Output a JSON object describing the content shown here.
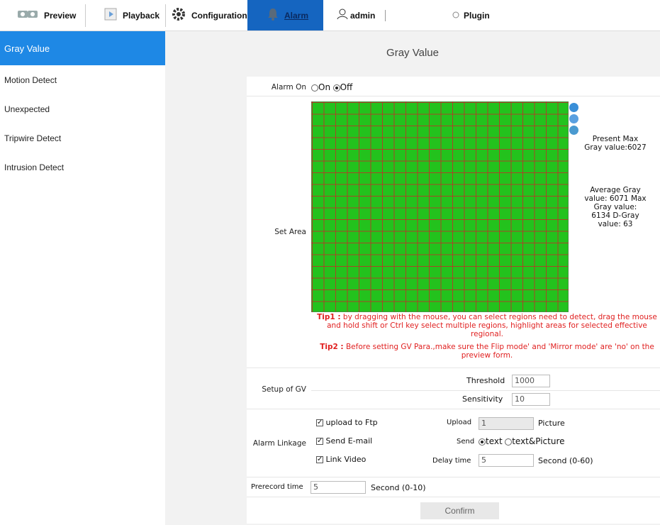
{
  "nav": {
    "items": [
      {
        "label": "Preview",
        "icon": "camera-icon"
      },
      {
        "label": "Playback",
        "icon": "playback-icon"
      },
      {
        "label": "Configuration",
        "icon": "gear-icon"
      },
      {
        "label": "Alarm",
        "icon": "bell-icon"
      },
      {
        "label": "admin",
        "icon": "user-icon"
      },
      {
        "label": "Plugin",
        "icon": "plugin-icon"
      }
    ],
    "active": "Alarm",
    "accent_color": "#1565c0"
  },
  "sidebar": {
    "items": [
      {
        "label": "Gray Value"
      },
      {
        "label": "Motion Detect"
      },
      {
        "label": "Unexpected"
      },
      {
        "label": "Tripwire Detect"
      },
      {
        "label": "Intrusion Detect"
      }
    ],
    "active_color": "#1e88e5"
  },
  "page_title": "Gray Value",
  "alarm_on": {
    "label": "Alarm On",
    "on_label": "On",
    "off_label": "Off",
    "selected": "Off"
  },
  "set_area": {
    "label": "Set Area",
    "grid_color": "#23c21d",
    "present_max": "Present Max Gray value:6027",
    "stats": "Average Gray value: 6071 Max Gray value: 6134 D-Gray value: 63"
  },
  "tips": {
    "tip1_label": "Tip1 :",
    "tip1_text": " by dragging with the mouse, you can select regions need to detect, drag the mouse and hold shift or Ctrl key select multiple regions, highlight areas for selected effective regional.",
    "tip2_label": "Tip2 :",
    "tip2_text": " Before setting GV Para.,make sure the Flip mode' and 'Mirror mode' are 'no' on the preview form."
  },
  "setup_gv": {
    "label": "Setup of GV",
    "threshold_label": "Threshold",
    "threshold_value": "1000",
    "sensitivity_label": "Sensitivity",
    "sensitivity_value": "10"
  },
  "alarm_linkage": {
    "label": "Alarm Linkage",
    "upload_ftp": "upload to Ftp",
    "send_email": "Send E-mail",
    "link_video": "Link Video",
    "upload_label": "Upload",
    "upload_value": "1",
    "picture_label": "Picture",
    "send_label": "Send",
    "send_text": "text",
    "send_text_picture": "text&Picture",
    "send_selected": "text",
    "delay_label": "Delay time",
    "delay_value": "5",
    "delay_unit": "Second (0-60)"
  },
  "prerecord": {
    "label": "Prerecord time",
    "value": "5",
    "unit": "Second (0-10)"
  },
  "confirm_label": "Confirm"
}
